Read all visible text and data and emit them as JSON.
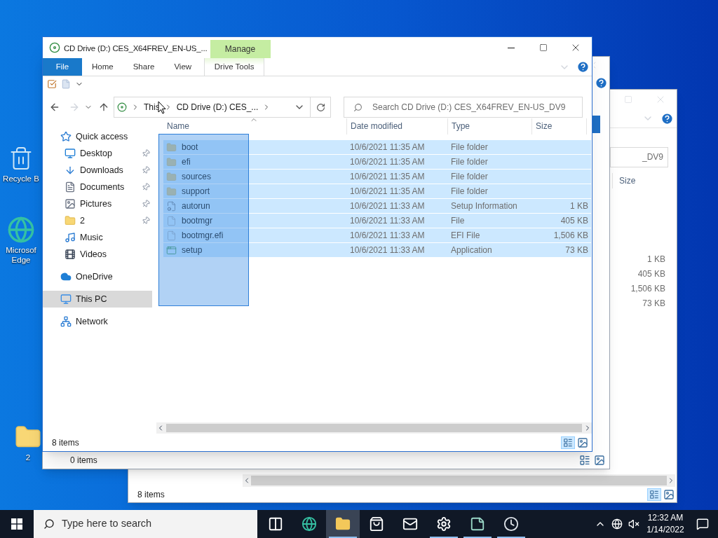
{
  "desktop_icons": [
    {
      "kind": "recycle",
      "label": "Recycle B"
    },
    {
      "kind": "edge",
      "label": "Microsof Edge"
    },
    {
      "kind": "folder",
      "label": "2"
    }
  ],
  "back_window": {
    "search_value": "_DV9",
    "size_header": "Size",
    "sizes": [
      "1 KB",
      "405 KB",
      "1,506 KB",
      "73 KB"
    ],
    "status": "8 items"
  },
  "middle_window": {
    "status": "0 items"
  },
  "window": {
    "title": "CD Drive (D:) CES_X64FREV_EN-US_...",
    "context_tab": "Manage",
    "context_subtab": "Drive Tools",
    "tabs": [
      {
        "label": "File",
        "selected": true
      },
      {
        "label": "Home",
        "selected": false
      },
      {
        "label": "Share",
        "selected": false
      },
      {
        "label": "View",
        "selected": false
      }
    ],
    "breadcrumbs": [
      "This",
      "CD Drive (D:) CES_..."
    ],
    "search_placeholder": "Search CD Drive (D:) CES_X64FREV_EN-US_DV9",
    "sidebar": [
      {
        "kind": "star",
        "label": "Quick access",
        "selected": false,
        "children": [
          {
            "kind": "desktop",
            "label": "Desktop",
            "pinned": true,
            "selected": false
          },
          {
            "kind": "downloads",
            "label": "Downloads",
            "pinned": true,
            "selected": false
          },
          {
            "kind": "documents",
            "label": "Documents",
            "pinned": true,
            "selected": false
          },
          {
            "kind": "pictures",
            "label": "Pictures",
            "pinned": true,
            "selected": false
          },
          {
            "kind": "folder",
            "label": "2",
            "pinned": true,
            "selected": false
          },
          {
            "kind": "music",
            "label": "Music",
            "pinned": false,
            "selected": false
          },
          {
            "kind": "videos",
            "label": "Videos",
            "pinned": false,
            "selected": false
          }
        ]
      },
      {
        "kind": "onedrive",
        "label": "OneDrive",
        "selected": false
      },
      {
        "kind": "pc",
        "label": "This PC",
        "selected": true
      },
      {
        "kind": "network",
        "label": "Network",
        "selected": false
      }
    ],
    "columns": [
      "Name",
      "Date modified",
      "Type",
      "Size"
    ],
    "rows": [
      {
        "kind": "folder",
        "name": "boot",
        "date": "10/6/2021 11:35 AM",
        "type": "File folder",
        "selected": true
      },
      {
        "kind": "folder",
        "name": "efi",
        "date": "10/6/2021 11:35 AM",
        "type": "File folder",
        "selected": true
      },
      {
        "kind": "folder",
        "name": "sources",
        "date": "10/6/2021 11:35 AM",
        "type": "File folder",
        "selected": true
      },
      {
        "kind": "folder",
        "name": "support",
        "date": "10/6/2021 11:35 AM",
        "type": "File folder",
        "selected": true
      },
      {
        "kind": "setup-info",
        "name": "autorun",
        "date": "10/6/2021 11:33 AM",
        "type": "Setup Information",
        "size": "1 KB",
        "selected": true
      },
      {
        "kind": "file",
        "name": "bootmgr",
        "date": "10/6/2021 11:33 AM",
        "type": "File",
        "size": "405 KB",
        "selected": true
      },
      {
        "kind": "file",
        "name": "bootmgr.efi",
        "date": "10/6/2021 11:33 AM",
        "type": "EFI File",
        "size": "1,506 KB",
        "selected": true
      },
      {
        "kind": "app",
        "name": "setup",
        "date": "10/6/2021 11:33 AM",
        "type": "Application",
        "size": "73 KB",
        "selected": true
      }
    ],
    "status": "8 items"
  },
  "taskbar": {
    "search_placeholder": "Type here to search",
    "apps": [
      {
        "kind": "taskview",
        "selected": false,
        "running": false
      },
      {
        "kind": "edge",
        "selected": false,
        "running": false
      },
      {
        "kind": "explorer",
        "selected": true,
        "running": true
      },
      {
        "kind": "store",
        "selected": false,
        "running": false
      },
      {
        "kind": "mail",
        "selected": false,
        "running": false
      },
      {
        "kind": "settings",
        "selected": false,
        "running": true
      },
      {
        "kind": "notes",
        "selected": false,
        "running": true
      },
      {
        "kind": "clock",
        "selected": false,
        "running": true
      }
    ],
    "time": "12:32 AM",
    "date": "1/14/2022"
  }
}
